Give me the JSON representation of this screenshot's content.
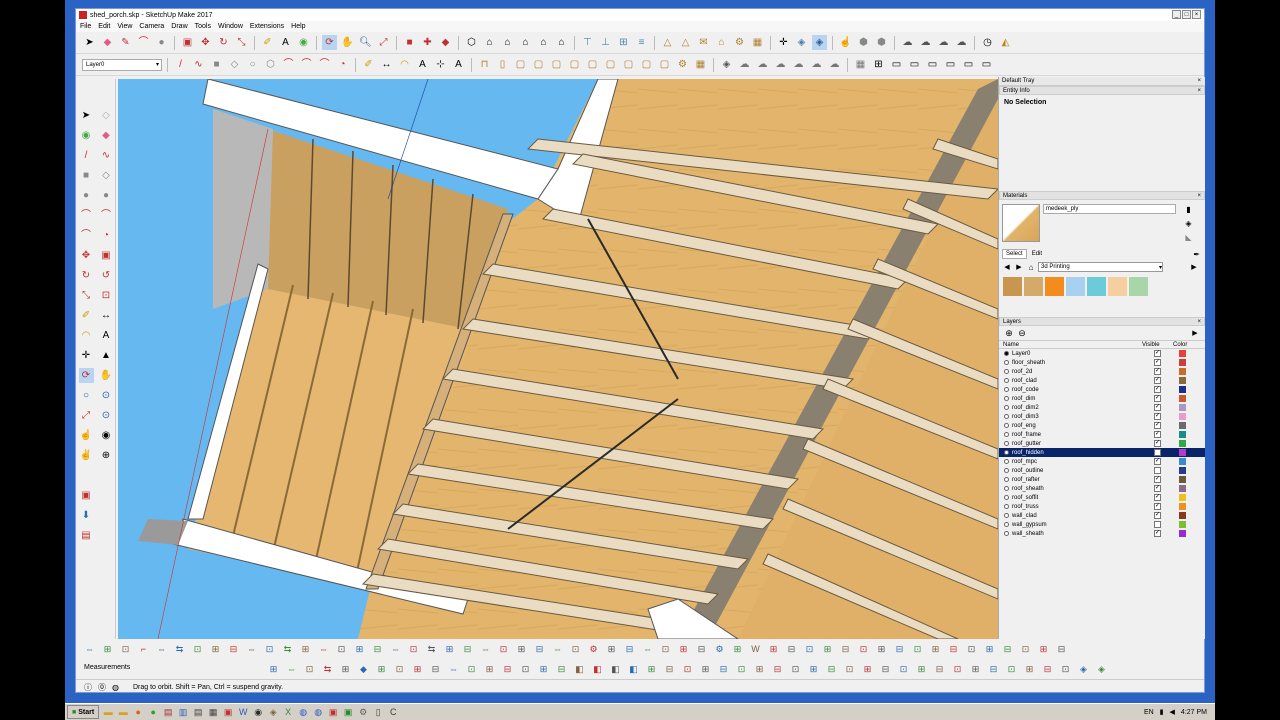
{
  "window": {
    "title": "shed_porch.skp - SketchUp Make 2017",
    "controls": [
      "_",
      "□",
      "×"
    ]
  },
  "menu": [
    "File",
    "Edit",
    "View",
    "Camera",
    "Draw",
    "Tools",
    "Window",
    "Extensions",
    "Help"
  ],
  "layer_toolbar": {
    "current_layer": "Layer0"
  },
  "tray": {
    "title": "Default Tray",
    "entity_info": {
      "header": "Entity Info",
      "selection": "No Selection"
    },
    "materials": {
      "header": "Materials",
      "current_name": "medeek_ply",
      "tabs": [
        "Select",
        "Edit"
      ],
      "library": "3d Printing",
      "swatches": [
        "#c8964f",
        "#d4aa6a",
        "#f28c1c",
        "#a8d0f0",
        "#6ccbd8",
        "#f5cfa0",
        "#a9d6a8"
      ]
    },
    "layers": {
      "header": "Layers",
      "columns": {
        "name": "Name",
        "visible": "Visible",
        "color": "Color"
      },
      "rows": [
        {
          "name": "Layer0",
          "visible": true,
          "active": true,
          "color": "#e8403a"
        },
        {
          "name": "floor_sheath",
          "visible": true,
          "active": false,
          "color": "#cc3d3d"
        },
        {
          "name": "roof_2d",
          "visible": true,
          "active": false,
          "color": "#c96c2a"
        },
        {
          "name": "roof_clad",
          "visible": true,
          "active": false,
          "color": "#8a6a3a"
        },
        {
          "name": "roof_code",
          "visible": true,
          "active": false,
          "color": "#1b2f8c"
        },
        {
          "name": "roof_dim",
          "visible": true,
          "active": false,
          "color": "#c85a2e"
        },
        {
          "name": "roof_dim2",
          "visible": true,
          "active": false,
          "color": "#a997c8"
        },
        {
          "name": "roof_dim3",
          "visible": true,
          "active": false,
          "color": "#e89cc8"
        },
        {
          "name": "roof_eng",
          "visible": true,
          "active": false,
          "color": "#6a6a6a"
        },
        {
          "name": "roof_frame",
          "visible": true,
          "active": false,
          "color": "#1c8a8a"
        },
        {
          "name": "roof_gutter",
          "visible": true,
          "active": false,
          "color": "#2ea848"
        },
        {
          "name": "roof_hidden",
          "visible": false,
          "active": false,
          "color": "#b53ad0",
          "selected": true
        },
        {
          "name": "roof_mpc",
          "visible": true,
          "active": false,
          "color": "#3a8ad0"
        },
        {
          "name": "roof_outline",
          "visible": false,
          "active": false,
          "color": "#2a3a8a"
        },
        {
          "name": "roof_rafter",
          "visible": true,
          "active": false,
          "color": "#6a5a3a"
        },
        {
          "name": "roof_sheath",
          "visible": true,
          "active": false,
          "color": "#8a6a8a"
        },
        {
          "name": "roof_soffit",
          "visible": true,
          "active": false,
          "color": "#f0c020"
        },
        {
          "name": "roof_truss",
          "visible": true,
          "active": false,
          "color": "#f09020"
        },
        {
          "name": "wall_clad",
          "visible": true,
          "active": false,
          "color": "#8a3a1a"
        },
        {
          "name": "wall_gypsum",
          "visible": false,
          "active": false,
          "color": "#7ac030"
        },
        {
          "name": "wall_sheath",
          "visible": true,
          "active": false,
          "color": "#9a2ad0"
        }
      ]
    }
  },
  "measurements_label": "Measurements",
  "status_text": "Drag to orbit. Shift = Pan, Ctrl = suspend gravity.",
  "taskbar": {
    "start_label": "Start",
    "language": "EN",
    "time": "4:27 PM"
  },
  "icons": {
    "top_row1": [
      "select-icon",
      "eraser-icon",
      "pencil-icon",
      "arc-icon",
      "shape-icon",
      "move-icon",
      "rotate-icon",
      "scale-icon",
      "tape-icon",
      "text-icon",
      "paint-icon",
      "orbit-icon",
      "pan-icon",
      "zoom-icon",
      "zoom-extents-icon",
      "warehouse-icon",
      "extension-icon",
      "iso-view-icon",
      "top-view-icon",
      "front-view-icon",
      "right-view-icon",
      "back-view-icon",
      "left-view-icon",
      "section-icon",
      "sandbox-icon",
      "solid-icon",
      "gear-icon",
      "camera-icon",
      "walk-icon"
    ],
    "left": [
      "select-icon",
      "eraser-icon",
      "pencil-icon",
      "line-icon",
      "rect-icon",
      "circle-icon",
      "arc-icon",
      "push-pull-icon",
      "move-icon",
      "rotate-icon",
      "offset-icon",
      "tape-icon",
      "text-icon",
      "axes-icon",
      "orbit-icon",
      "pan-icon",
      "zoom-icon",
      "zoom-extents-icon",
      "position-camera-icon",
      "look-around-icon",
      "walk-icon",
      "section-plane-icon"
    ]
  }
}
